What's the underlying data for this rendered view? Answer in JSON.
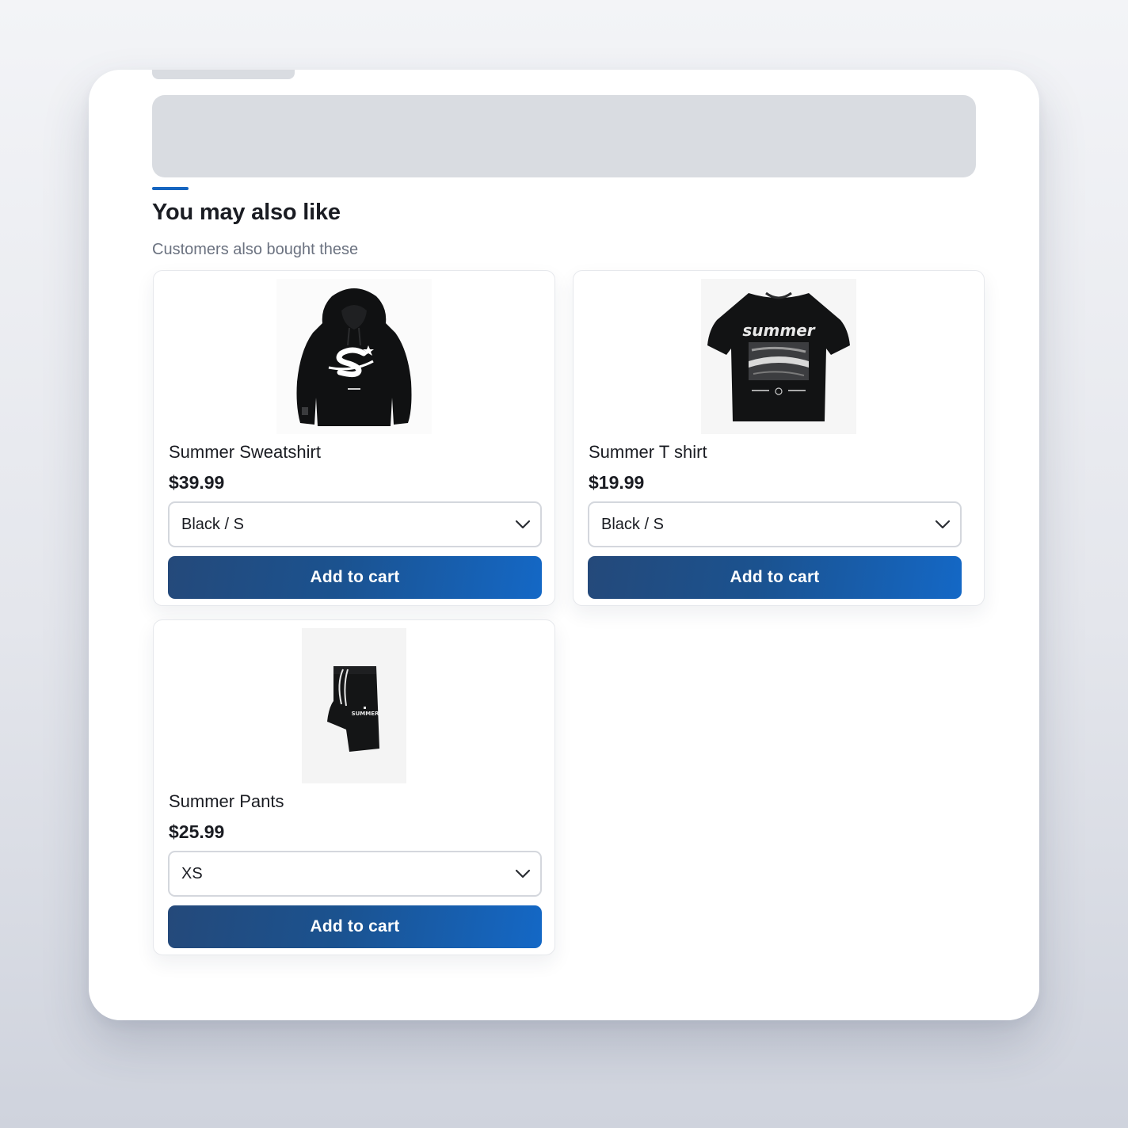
{
  "section": {
    "title": "You may also like",
    "subtitle": "Customers also bought these",
    "accent_color": "#1565c0"
  },
  "products": [
    {
      "name": "Summer Sweatshirt",
      "price": "$39.99",
      "variant": "Black / S",
      "button_label": "Add to cart",
      "image": "black-hoodie-image"
    },
    {
      "name": "Summer T shirt",
      "price": "$19.99",
      "variant": "Black / S",
      "button_label": "Add to cart",
      "image": "black-tshirt-image"
    },
    {
      "name": "Summer Pants",
      "price": "$25.99",
      "variant": "XS",
      "button_label": "Add to cart",
      "image": "black-shorts-image"
    }
  ],
  "icons": {
    "dropdown": "chevron-down-icon"
  },
  "colors": {
    "button_gradient_start": "#24497a",
    "button_gradient_end": "#1468c6",
    "skeleton": "#d9dce1"
  }
}
